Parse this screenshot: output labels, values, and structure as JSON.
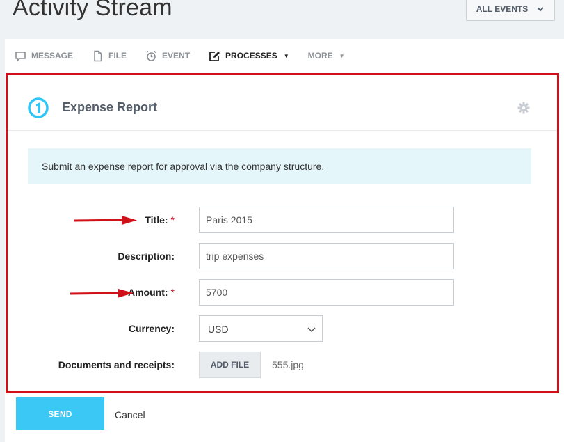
{
  "header": {
    "title": "Activity Stream",
    "filter_label": "ALL EVENTS"
  },
  "toolbar": {
    "items": [
      {
        "label": "MESSAGE",
        "icon": "chat-bubble-icon"
      },
      {
        "label": "FILE",
        "icon": "file-icon"
      },
      {
        "label": "EVENT",
        "icon": "alarm-clock-icon"
      },
      {
        "label": "PROCESSES",
        "icon": "edit-icon",
        "active": true
      },
      {
        "label": "MORE"
      }
    ]
  },
  "form": {
    "title": "Expense Report",
    "description": "Submit an expense report for approval via the company structure.",
    "fields": {
      "title": {
        "label": "Title:",
        "value": "Paris 2015",
        "required": "*"
      },
      "description": {
        "label": "Description:",
        "value": "trip expenses"
      },
      "amount": {
        "label": "Amount:",
        "value": "5700",
        "required": "*"
      },
      "currency": {
        "label": "Currency:",
        "value": "USD"
      },
      "documents": {
        "label": "Documents and receipts:",
        "button": "ADD FILE",
        "file": "555.jpg"
      }
    }
  },
  "actions": {
    "send": "SEND",
    "cancel": "Cancel"
  },
  "colors": {
    "accent": "#3bc8f5",
    "highlight_border": "#d0111a",
    "info_bg": "#e5f6fb"
  }
}
